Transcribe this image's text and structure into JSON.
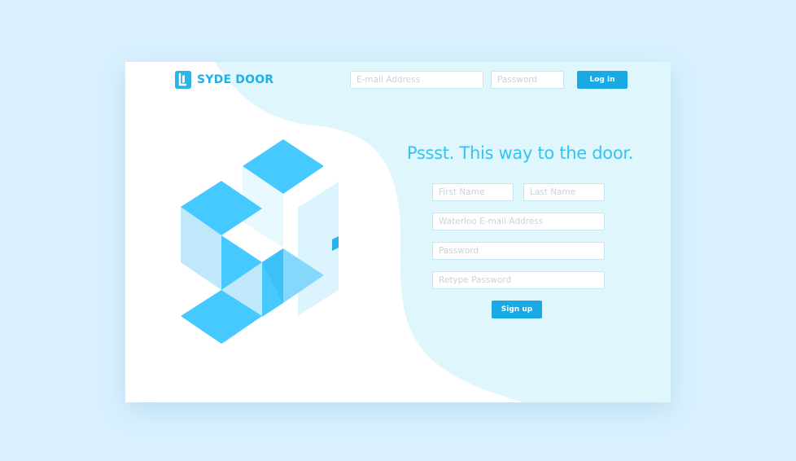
{
  "brand": {
    "name": "SYDE DOOR",
    "logo_icon": "door-icon",
    "color": "#1fb0e6"
  },
  "header": {
    "email_placeholder": "E-mail Address",
    "password_placeholder": "Password",
    "login_label": "Log in"
  },
  "signup": {
    "headline": "Pssst. This way to the door.",
    "first_name_placeholder": "First Name",
    "last_name_placeholder": "Last Name",
    "email_placeholder": "Waterloo E-mail Address",
    "password_placeholder": "Password",
    "retype_placeholder": "Retype Password",
    "submit_label": "Sign up"
  },
  "colors": {
    "page_background": "#d9f1fe",
    "panel_background": "#dff6fd",
    "accent": "#1ba9e3",
    "headline": "#36c3f0"
  }
}
